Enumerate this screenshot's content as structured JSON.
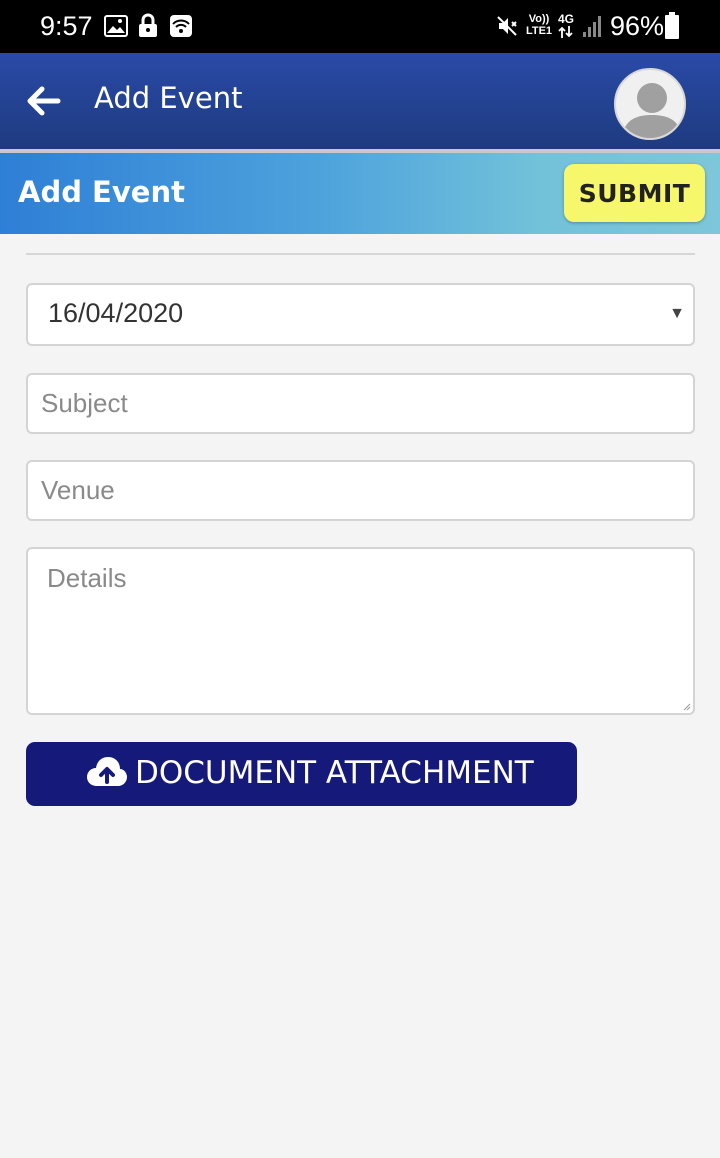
{
  "status_bar": {
    "time": "9:57",
    "battery": "96%",
    "icons": [
      "gallery-icon",
      "lock-icon",
      "wifi-icon",
      "mute-icon",
      "volte-icon",
      "4g-icon",
      "signal-icon",
      "battery-icon"
    ],
    "volte_label": "Vo)) LTE1",
    "network_label": "4G"
  },
  "appbar": {
    "title": "Add Event",
    "back_icon": "arrow-left-icon",
    "avatar_icon": "user-avatar-icon",
    "background": "#22418f"
  },
  "banner": {
    "title": "Add Event",
    "submit_label": "SUBMIT",
    "submit_color": "#f6f76a"
  },
  "form": {
    "date": {
      "value": "16/04/2020"
    },
    "subject": {
      "placeholder": "Subject",
      "value": ""
    },
    "venue": {
      "placeholder": "Venue",
      "value": ""
    },
    "details": {
      "placeholder": "Details",
      "value": ""
    },
    "attachment": {
      "label": "DOCUMENT ATTACHMENT",
      "icon": "cloud-upload-icon",
      "color": "#15197a"
    }
  }
}
